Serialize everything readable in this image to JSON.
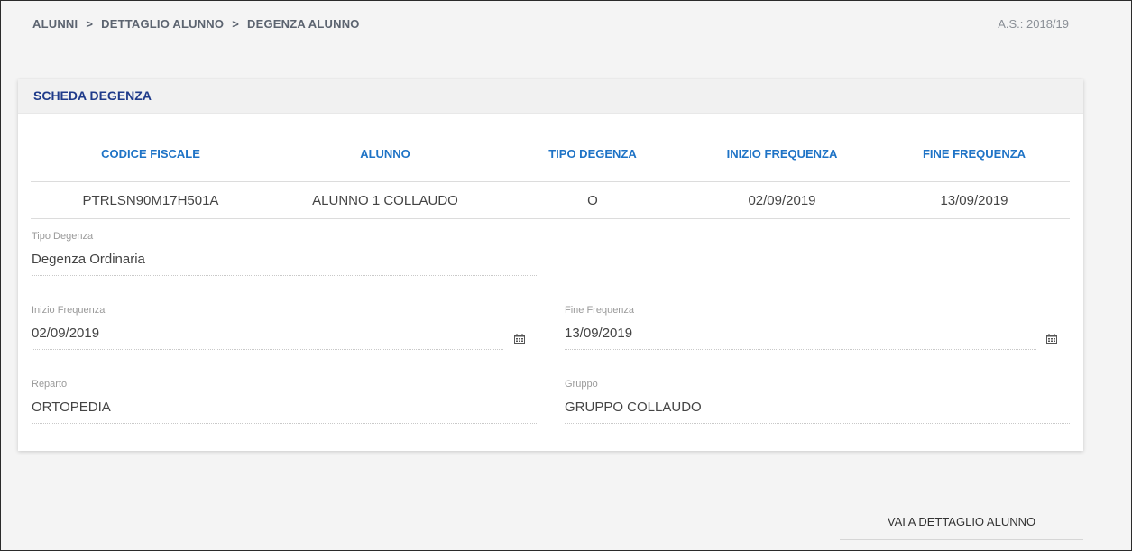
{
  "breadcrumb": {
    "items": [
      "ALUNNI",
      "DETTAGLIO ALUNNO",
      "DEGENZA ALUNNO"
    ],
    "separator": ">"
  },
  "anno_scolastico": "A.S.: 2018/19",
  "card": {
    "title": "SCHEDA DEGENZA",
    "table": {
      "headers": [
        "CODICE FISCALE",
        "ALUNNO",
        "TIPO DEGENZA",
        "INIZIO FREQUENZA",
        "FINE FREQUENZA"
      ],
      "rows": [
        [
          "PTRLSN90M17H501A",
          "ALUNNO 1 COLLAUDO",
          "O",
          "02/09/2019",
          "13/09/2019"
        ]
      ]
    },
    "fields": {
      "tipo_degenza": {
        "label": "Tipo Degenza",
        "value": "Degenza Ordinaria"
      },
      "inizio_frequenza": {
        "label": "Inizio Frequenza",
        "value": "02/09/2019",
        "icon": "calendar-icon"
      },
      "fine_frequenza": {
        "label": "Fine Frequenza",
        "value": "13/09/2019",
        "icon": "calendar-icon"
      },
      "reparto": {
        "label": "Reparto",
        "value": "ORTOPEDIA"
      },
      "gruppo": {
        "label": "Gruppo",
        "value": "GRUPPO COLLAUDO"
      }
    }
  },
  "footer": {
    "back_link": "VAI A DETTAGLIO ALUNNO"
  },
  "colors": {
    "title": "#1e3a8a",
    "header_text": "#1e73c6",
    "background": "#f4f4f4"
  }
}
